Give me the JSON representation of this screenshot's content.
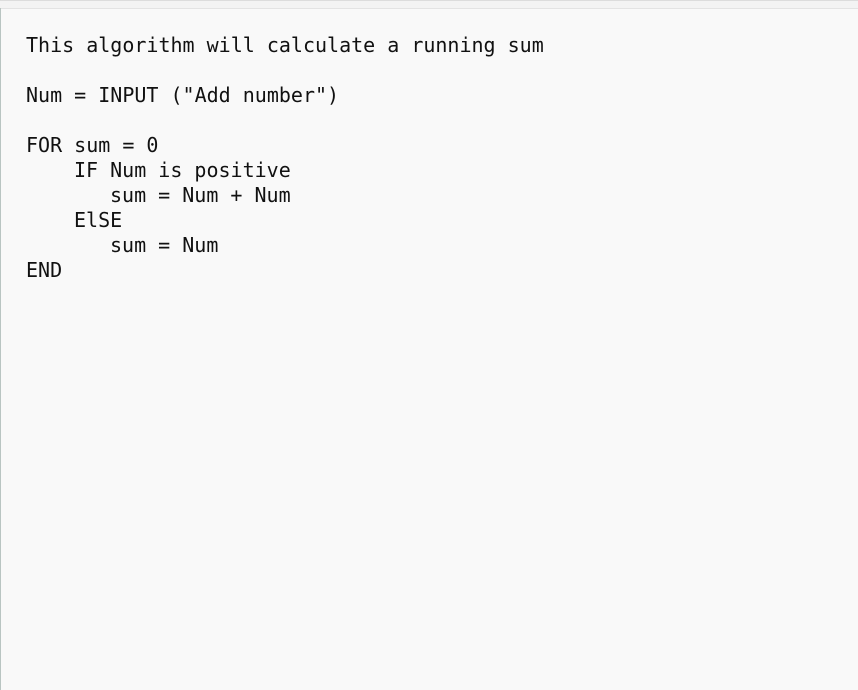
{
  "editor": {
    "lines": [
      {
        "text": "This algorithm will calculate a running sum",
        "indent": 0
      },
      {
        "text": "",
        "indent": 0
      },
      {
        "text": "Num = INPUT (\"Add number\")",
        "indent": 0
      },
      {
        "text": "",
        "indent": 0
      },
      {
        "text": "FOR sum = 0",
        "indent": 0
      },
      {
        "text": "IF Num is positive",
        "indent": 1
      },
      {
        "text": "sum = Num + Num",
        "indent": 2
      },
      {
        "text": "ElSE",
        "indent": 1
      },
      {
        "text": "sum = Num",
        "indent": 2
      },
      {
        "text": "END",
        "indent": 0
      }
    ]
  }
}
